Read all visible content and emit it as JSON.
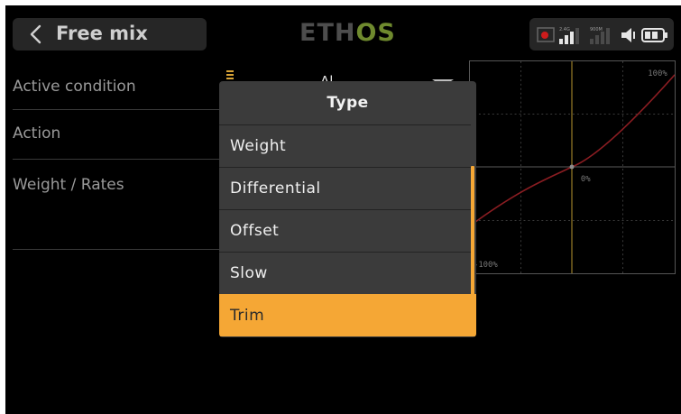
{
  "header": {
    "title": "Free mix",
    "logo_main": "ETH",
    "logo_accent": "OS",
    "status": {
      "signal_1_label": "2.4G",
      "signal_2_label": "900M"
    }
  },
  "form": {
    "rows": [
      {
        "label": "Active condition"
      },
      {
        "label": "Action"
      },
      {
        "label": "Weight / Rates"
      }
    ],
    "active_condition_value_partial": "Al"
  },
  "curve": {
    "top_right_label": "100%",
    "center_label": "0%",
    "bottom_left_label": "-100%",
    "line_color": "#8b1d22",
    "guide_color": "#b8962f"
  },
  "dialog": {
    "title": "Type",
    "options": [
      {
        "label": "Weight"
      },
      {
        "label": "Differential"
      },
      {
        "label": "Offset"
      },
      {
        "label": "Slow"
      },
      {
        "label": "Trim"
      }
    ],
    "selected_index": 4,
    "accent_color": "#f5a735"
  }
}
